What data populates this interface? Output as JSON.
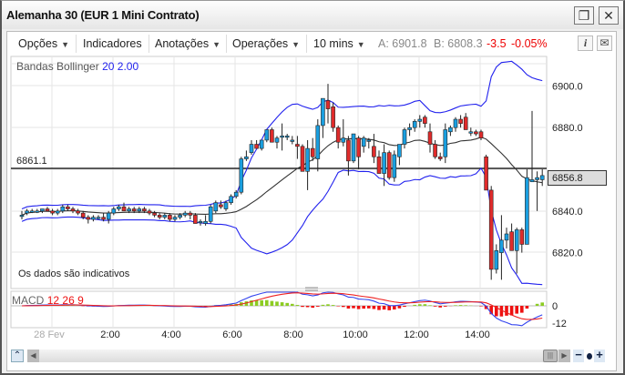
{
  "window": {
    "title": "Alemanha 30 (EUR 1 Mini Contrato)"
  },
  "toolbar": {
    "options": "Opções",
    "indicators": "Indicadores",
    "annotations": "Anotações",
    "operations": "Operações",
    "interval": "10 mins",
    "ask": "A: 6901.8",
    "bid": "B: 6808.3",
    "change": "-3.5",
    "change_pct": "-0.05%"
  },
  "indicator": {
    "name": "Bandas Bollinger",
    "period": "20",
    "dev": "2.00"
  },
  "macd": {
    "name": "MACD",
    "fast": "12",
    "slow": "26",
    "signal": "9",
    "ticks": [
      "0",
      "-12"
    ]
  },
  "notice": "Os dados são indicativos",
  "reference_line": "6861.1",
  "current_price": "6856.8",
  "colors": {
    "up": "#1a9fe0",
    "down": "#e02b2b",
    "bands": "#2222ee",
    "sma": "#333333",
    "macd": "#3344ee",
    "signal": "#ee2222",
    "hist_pos": "#8ccc22",
    "hist_neg": "#ee1111"
  },
  "chart_data": {
    "type": "candlestick",
    "y_ticks": [
      "6900.0",
      "6880.0",
      "6840.0",
      "6820.0"
    ],
    "y_tick_values": [
      6900,
      6880,
      6840,
      6820
    ],
    "x_ticks": [
      "28 Fev",
      "2:00",
      "4:00",
      "6:00",
      "8:00",
      "10:00",
      "12:00",
      "14:00"
    ],
    "bollinger": {
      "period": 20,
      "dev": 2
    },
    "candles": [
      [
        6838,
        6840,
        6836,
        6838
      ],
      [
        6839,
        6841,
        6838,
        6840
      ],
      [
        6840,
        6841,
        6839,
        6840
      ],
      [
        6840,
        6841,
        6839,
        6840
      ],
      [
        6840,
        6841,
        6839,
        6841
      ],
      [
        6841,
        6842,
        6840,
        6840
      ],
      [
        6840,
        6841,
        6838,
        6839
      ],
      [
        6839,
        6841,
        6838,
        6840
      ],
      [
        6840,
        6843,
        6839,
        6842
      ],
      [
        6842,
        6843,
        6840,
        6841
      ],
      [
        6841,
        6842,
        6839,
        6840
      ],
      [
        6840,
        6841,
        6838,
        6839
      ],
      [
        6839,
        6840,
        6836,
        6837
      ],
      [
        6837,
        6838,
        6834,
        6836
      ],
      [
        6836,
        6838,
        6835,
        6837
      ],
      [
        6837,
        6838,
        6836,
        6837
      ],
      [
        6837,
        6839,
        6835,
        6836
      ],
      [
        6836,
        6840,
        6834,
        6839
      ],
      [
        6839,
        6842,
        6838,
        6841
      ],
      [
        6841,
        6843,
        6840,
        6842
      ],
      [
        6842,
        6844,
        6840,
        6840
      ],
      [
        6840,
        6842,
        6839,
        6841
      ],
      [
        6841,
        6842,
        6839,
        6840
      ],
      [
        6840,
        6842,
        6839,
        6841
      ],
      [
        6841,
        6842,
        6839,
        6840
      ],
      [
        6840,
        6841,
        6838,
        6839
      ],
      [
        6839,
        6840,
        6837,
        6838
      ],
      [
        6838,
        6839,
        6836,
        6837
      ],
      [
        6837,
        6839,
        6836,
        6838
      ],
      [
        6838,
        6839,
        6835,
        6836
      ],
      [
        6836,
        6838,
        6835,
        6837
      ],
      [
        6837,
        6839,
        6836,
        6838
      ],
      [
        6838,
        6840,
        6837,
        6839
      ],
      [
        6839,
        6840,
        6836,
        6838
      ],
      [
        6838,
        6839,
        6834,
        6834
      ],
      [
        6835,
        6836,
        6833,
        6835
      ],
      [
        6834,
        6838,
        6833,
        6835
      ],
      [
        6835,
        6843,
        6834,
        6842
      ],
      [
        6840,
        6845,
        6839,
        6844
      ],
      [
        6843,
        6845,
        6841,
        6842
      ],
      [
        6841,
        6845,
        6840,
        6844
      ],
      [
        6844,
        6848,
        6843,
        6847
      ],
      [
        6847,
        6850,
        6846,
        6849
      ],
      [
        6849,
        6866,
        6848,
        6865
      ],
      [
        6865,
        6869,
        6864,
        6866
      ],
      [
        6868,
        6874,
        6867,
        6872
      ],
      [
        6872,
        6874,
        6870,
        6870
      ],
      [
        6870,
        6874,
        6869,
        6874
      ],
      [
        6874,
        6879,
        6873,
        6879
      ],
      [
        6879,
        6880,
        6873,
        6873
      ],
      [
        6873,
        6876,
        6870,
        6875
      ],
      [
        6876,
        6882,
        6869,
        6876
      ],
      [
        6876,
        6877,
        6874,
        6876
      ],
      [
        6874,
        6876,
        6872,
        6874
      ],
      [
        6872,
        6876,
        6865,
        6871
      ],
      [
        6871,
        6872,
        6860,
        6859
      ],
      [
        6859,
        6874,
        6850,
        6870
      ],
      [
        6870,
        6875,
        6864,
        6866
      ],
      [
        6865,
        6884,
        6859,
        6881
      ],
      [
        6881,
        6893,
        6875,
        6894
      ],
      [
        6893,
        6901,
        6882,
        6889
      ],
      [
        6890,
        6892,
        6878,
        6880
      ],
      [
        6880,
        6881,
        6870,
        6873
      ],
      [
        6873,
        6884,
        6871,
        6875
      ],
      [
        6874,
        6876,
        6857,
        6864
      ],
      [
        6864,
        6877,
        6863,
        6877
      ],
      [
        6875,
        6876,
        6860,
        6866
      ],
      [
        6871,
        6876,
        6868,
        6875
      ],
      [
        6874,
        6875,
        6870,
        6874
      ],
      [
        6871,
        6877,
        6863,
        6866
      ],
      [
        6866,
        6869,
        6858,
        6858
      ],
      [
        6858,
        6872,
        6852,
        6868
      ],
      [
        6868,
        6869,
        6855,
        6856
      ],
      [
        6856,
        6869,
        6854,
        6867
      ],
      [
        6866,
        6872,
        6862,
        6872
      ],
      [
        6872,
        6880,
        6870,
        6879
      ],
      [
        6879,
        6882,
        6876,
        6880
      ],
      [
        6880,
        6884,
        6878,
        6883
      ],
      [
        6883,
        6886,
        6880,
        6884
      ],
      [
        6885,
        6886,
        6880,
        6882
      ],
      [
        6878,
        6882,
        6868,
        6872
      ],
      [
        6872,
        6874,
        6865,
        6866
      ],
      [
        6866,
        6868,
        6864,
        6865
      ],
      [
        6866,
        6882,
        6863,
        6879
      ],
      [
        6878,
        6881,
        6876,
        6880
      ],
      [
        6880,
        6885,
        6878,
        6884
      ],
      [
        6884,
        6886,
        6880,
        6882
      ],
      [
        6885,
        6887,
        6879,
        6879
      ],
      [
        6878,
        6880,
        6876,
        6878
      ],
      [
        6878,
        6879,
        6876,
        6877
      ],
      [
        6878,
        6879,
        6874,
        6875
      ],
      [
        6866,
        6867,
        6850,
        6850
      ],
      [
        6850,
        6852,
        6807,
        6812
      ],
      [
        6812,
        6824,
        6810,
        6821
      ],
      [
        6820,
        6838,
        6807,
        6826
      ],
      [
        6826,
        6832,
        6822,
        6829
      ],
      [
        6830,
        6834,
        6821,
        6821
      ],
      [
        6821,
        6832,
        6810,
        6831
      ],
      [
        6831,
        6832,
        6820,
        6824
      ],
      [
        6824,
        6860,
        6826,
        6856
      ],
      [
        6854,
        6888,
        6854,
        6855
      ],
      [
        6855,
        6859,
        6840,
        6856
      ],
      [
        6855,
        6860,
        6852,
        6857
      ]
    ]
  }
}
